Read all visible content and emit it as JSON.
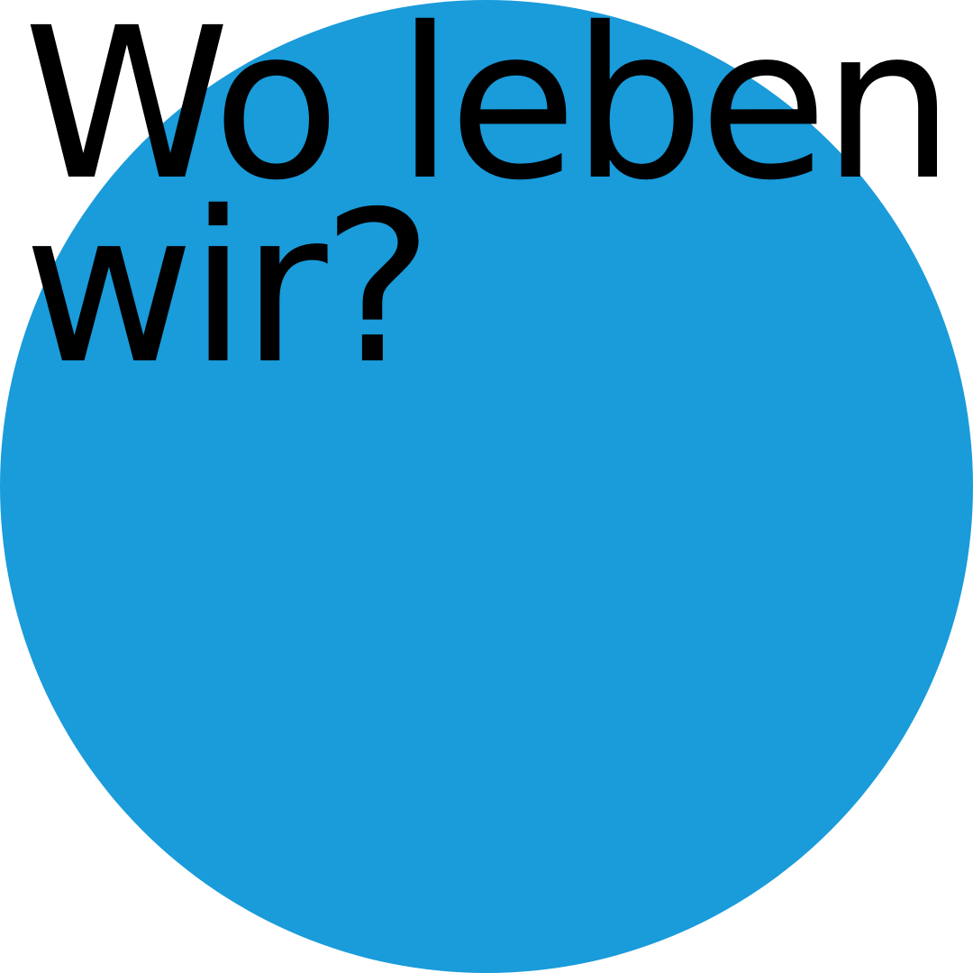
{
  "colors": {
    "background": "#ffffff",
    "circle": "#1a9bda",
    "text": "#000000"
  },
  "headline": {
    "line1": "Wo leben",
    "line2": "wir?"
  }
}
